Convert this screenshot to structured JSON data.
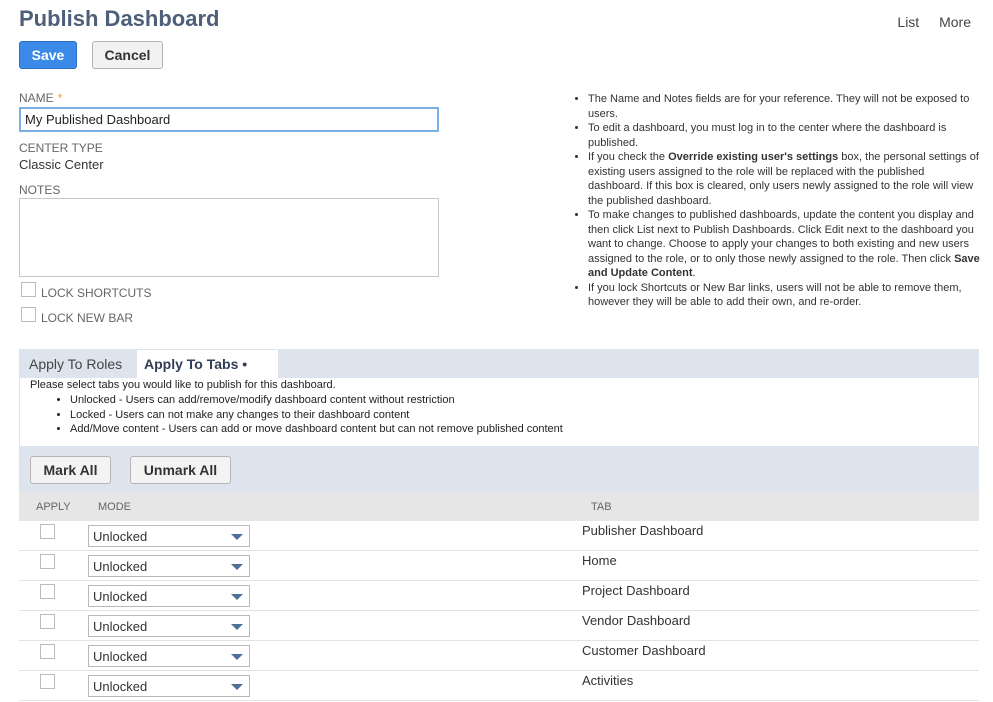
{
  "header": {
    "title": "Publish Dashboard",
    "links": [
      "List",
      "More"
    ]
  },
  "toolbar": {
    "save_label": "Save",
    "cancel_label": "Cancel"
  },
  "form": {
    "name_label": "NAME",
    "name_required": "*",
    "name_value": "My Published Dashboard",
    "center_type_label": "CENTER TYPE",
    "center_type_value": "Classic Center",
    "notes_label": "NOTES",
    "lock_shortcuts_label": "LOCK SHORTCUTS",
    "lock_new_bar_label": "LOCK NEW BAR"
  },
  "help": {
    "item1": "The Name and Notes fields are for your reference. They will not be exposed to users.",
    "item2": "To edit a dashboard, you must log in to the center where the dashboard is published.",
    "item3_pre": "If you check the ",
    "item3_bold": "Override existing user's settings",
    "item3_post": " box, the personal settings of existing users assigned to the role will be replaced with the published dashboard. If this box is cleared, only users newly assigned to the role will view the published dashboard.",
    "item4_pre": "To make changes to published dashboards, update the content you display and then click List next to Publish Dashboards. Click Edit next to the dashboard you want to change. Choose to apply your changes to both existing and new users assigned to the role, or to only those newly assigned to the role. Then click ",
    "item4_bold": "Save and Update Content",
    "item4_post": ".",
    "item5": "If you lock Shortcuts or New Bar links, users will not be able to remove them, however they will be able to add their own, and re-order."
  },
  "tabs": {
    "roles": "Apply To Roles",
    "tabs": "Apply To Tabs •"
  },
  "panel": {
    "intro": "Please select tabs you would like to publish for this dashboard.",
    "bullets": [
      "Unlocked - Users can add/remove/modify dashboard content without restriction",
      "Locked - Users can not make any changes to their dashboard content",
      "Add/Move content - Users can add or move dashboard content but can not remove published content"
    ]
  },
  "actions": {
    "mark_all": "Mark All",
    "unmark_all": "Unmark All"
  },
  "table": {
    "headers": {
      "apply": "APPLY",
      "mode": "MODE",
      "tab": "TAB"
    },
    "rows": [
      {
        "mode": "Unlocked",
        "tab": "Publisher Dashboard"
      },
      {
        "mode": "Unlocked",
        "tab": "Home"
      },
      {
        "mode": "Unlocked",
        "tab": "Project Dashboard"
      },
      {
        "mode": "Unlocked",
        "tab": "Vendor Dashboard"
      },
      {
        "mode": "Unlocked",
        "tab": "Customer Dashboard"
      },
      {
        "mode": "Unlocked",
        "tab": "Activities"
      }
    ]
  },
  "colors": {
    "accent": "#3b8ae8",
    "title": "#4d5f79",
    "tabbar": "#dde4ee"
  }
}
